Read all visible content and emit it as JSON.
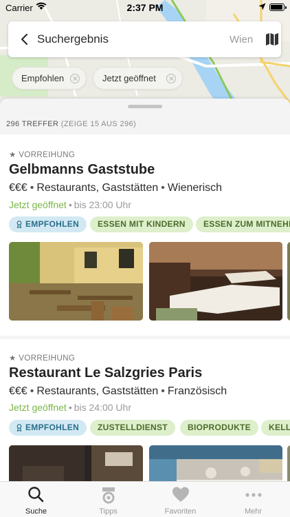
{
  "status_bar": {
    "carrier": "Carrier",
    "time": "2:37 PM"
  },
  "search": {
    "title": "Suchergebnis",
    "city": "Wien"
  },
  "filters": [
    {
      "label": "Empfohlen"
    },
    {
      "label": "Jetzt geöffnet"
    }
  ],
  "results": {
    "count": "296 TREFFER",
    "showing": "(ZEIGE 15 AUS 296)"
  },
  "listings": [
    {
      "tag": "★ VORREIHUNG",
      "name": "Gelbmanns Gaststube",
      "price": "€€€",
      "category": "Restaurants, Gaststätten",
      "cuisine": "Wienerisch",
      "open_status": "Jetzt geöffnet",
      "hours": "bis 23:00 Uhr",
      "badges": [
        "EMPFOHLEN",
        "ESSEN MIT KINDERN",
        "ESSEN ZUM MITNEHMEN"
      ]
    },
    {
      "tag": "★ VORREIHUNG",
      "name": "Restaurant Le Salzgries Paris",
      "price": "€€€",
      "category": "Restaurants, Gaststätten",
      "cuisine": "Französisch",
      "open_status": "Jetzt geöffnet",
      "hours": "bis 24:00 Uhr",
      "badges": [
        "EMPFOHLEN",
        "ZUSTELLDIENST",
        "BIOPRODUKTE",
        "KELLER"
      ]
    }
  ],
  "tabs": [
    {
      "label": "Suche",
      "icon": "search-icon",
      "active": true
    },
    {
      "label": "Tipps",
      "icon": "tipps-icon",
      "active": false
    },
    {
      "label": "Favoriten",
      "icon": "heart-icon",
      "active": false
    },
    {
      "label": "Mehr",
      "icon": "more-icon",
      "active": false
    }
  ],
  "colors": {
    "open_green": "#7ab648",
    "recommended_blue": "#d2e9f3",
    "feature_green": "#ddefcb"
  }
}
